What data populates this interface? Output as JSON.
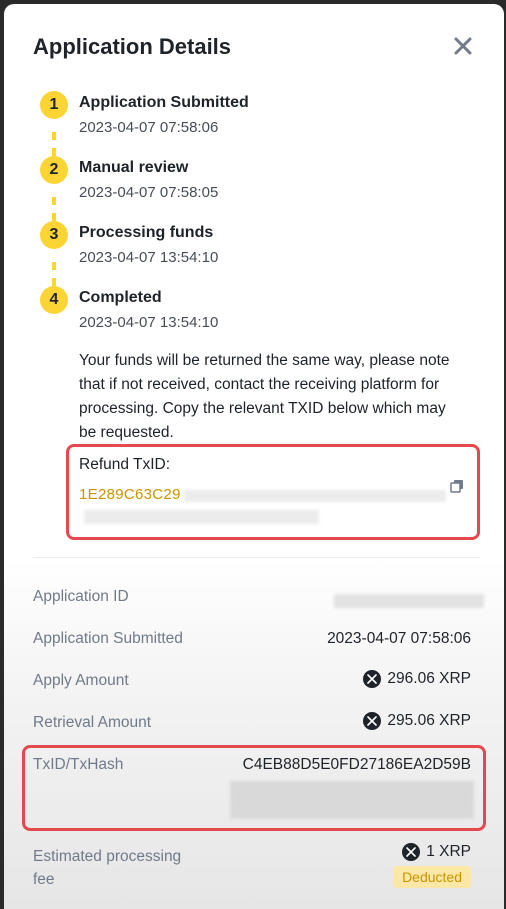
{
  "header": {
    "title": "Application Details"
  },
  "steps": [
    {
      "number": "1",
      "title": "Application Submitted",
      "time": "2023-04-07 07:58:06"
    },
    {
      "number": "2",
      "title": "Manual review",
      "time": "2023-04-07 07:58:05"
    },
    {
      "number": "3",
      "title": "Processing funds",
      "time": "2023-04-07 13:54:10"
    },
    {
      "number": "4",
      "title": "Completed",
      "time": "2023-04-07 13:54:10"
    }
  ],
  "note": "Your funds will be returned the same way, please note that if not received, contact the receiving platform for processing. Copy the relevant TXID below which may be requested.",
  "refund": {
    "label": "Refund TxID:",
    "value": "1E289C63C29"
  },
  "details": {
    "application_id": {
      "label": "Application ID",
      "value": ""
    },
    "submitted": {
      "label": "Application Submitted",
      "value": "2023-04-07 07:58:06"
    },
    "apply_amount": {
      "label": "Apply Amount",
      "value": "296.06 XRP"
    },
    "retrieval_amount": {
      "label": "Retrieval Amount",
      "value": "295.06 XRP"
    },
    "txid": {
      "label": "TxID/TxHash",
      "value": "C4EB88D5E0FD27186EA2D59B"
    },
    "fee": {
      "label_line1": "Estimated processing",
      "label_line2": "fee",
      "value": "1 XRP",
      "badge": "Deducted"
    }
  },
  "colors": {
    "accent": "#fcd535",
    "highlight_border": "#e5484d",
    "txid_text": "#c99400"
  },
  "icons": {
    "close": "close-icon",
    "copy": "copy-icon",
    "coin": "xrp-icon"
  }
}
